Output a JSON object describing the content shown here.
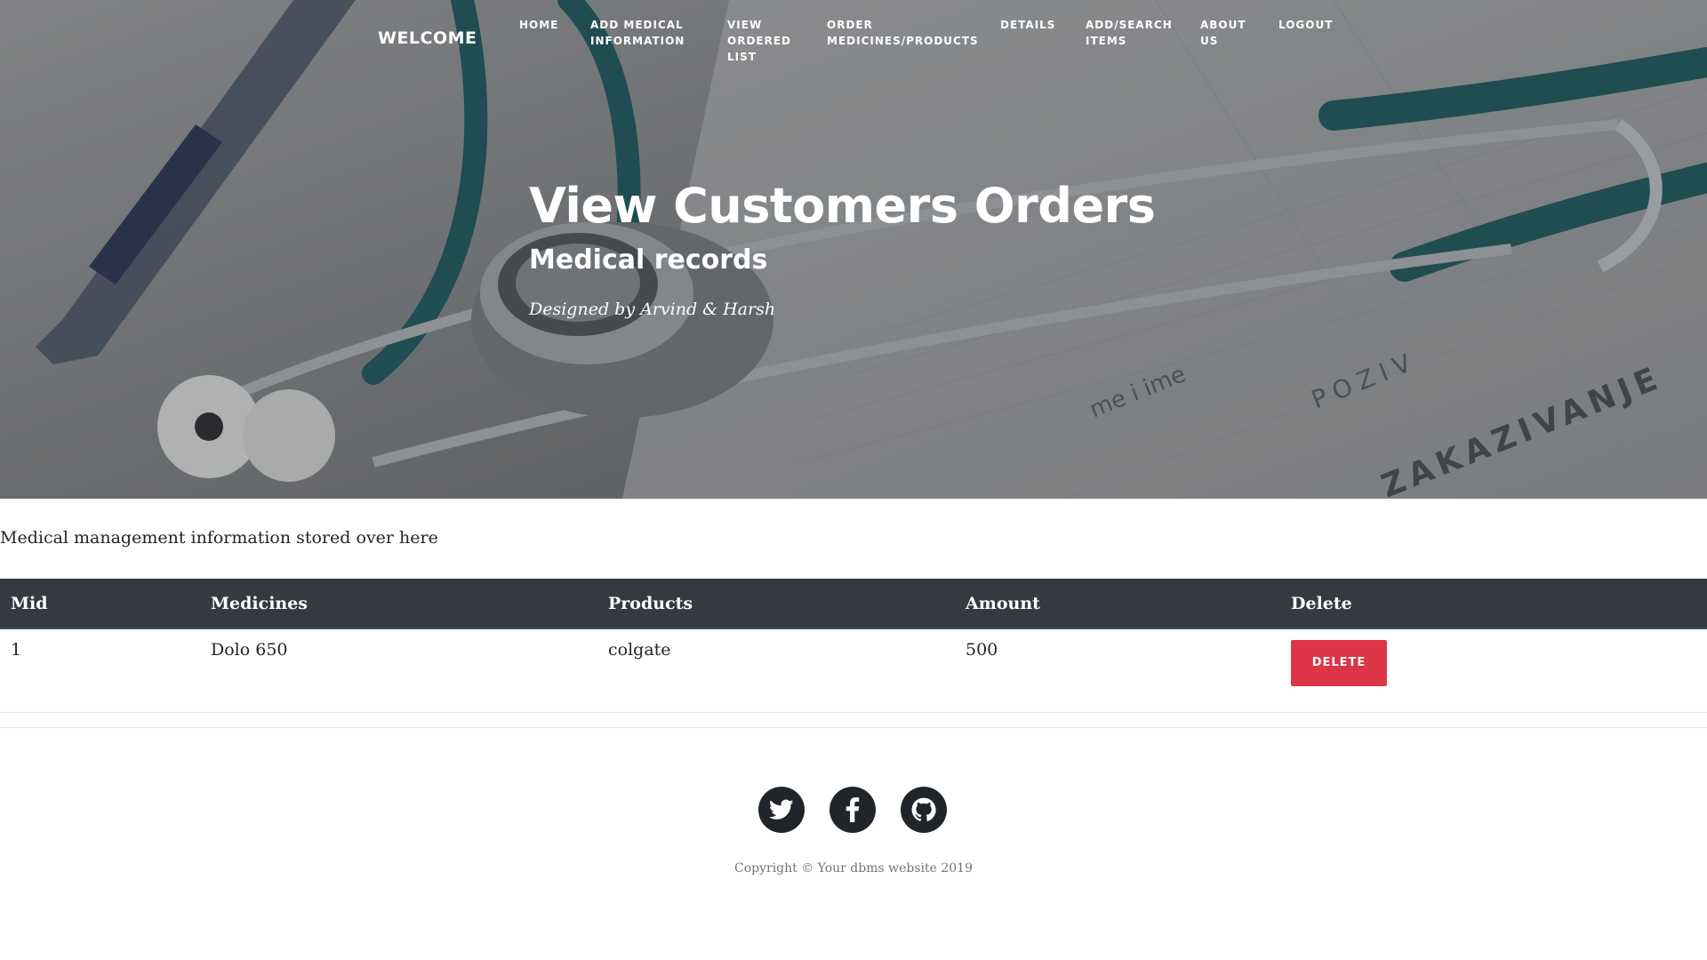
{
  "navbar": {
    "brand": "WELCOME",
    "items": [
      {
        "label": "HOME"
      },
      {
        "label": "ADD MEDICAL INFORMATION"
      },
      {
        "label": "VIEW ORDERED LIST"
      },
      {
        "label": "ORDER MEDICINES/PRODUCTS"
      },
      {
        "label": "DETAILS"
      },
      {
        "label": "ADD/SEARCH ITEMS"
      },
      {
        "label": "ABOUT US"
      },
      {
        "label": "LOGOUT"
      }
    ]
  },
  "hero": {
    "title": "View Customers Orders",
    "subtitle": "Medical records",
    "meta": "Designed by Arvind & Harsh",
    "image": "stethoscope-on-medical-form"
  },
  "main": {
    "intro": "Medical management information stored over here",
    "table": {
      "headers": [
        "Mid",
        "Medicines",
        "Products",
        "Amount",
        "Delete"
      ],
      "rows": [
        {
          "mid": "1",
          "medicines": "Dolo 650",
          "products": "colgate",
          "amount": "500",
          "action": "DELETE"
        }
      ]
    }
  },
  "footer": {
    "social": [
      {
        "icon": "twitter-icon"
      },
      {
        "icon": "facebook-icon"
      },
      {
        "icon": "github-icon"
      }
    ],
    "copyright": "Copyright © Your dbms website 2019"
  },
  "colors": {
    "table_header": "#343a40",
    "delete_button": "#dc3545",
    "social_icon_bg": "#212529",
    "copyright_text": "#6c757d"
  }
}
